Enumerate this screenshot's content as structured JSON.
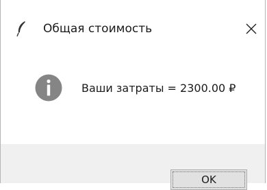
{
  "window": {
    "title": "Общая стоимость",
    "title_icon": "feather-icon",
    "close_icon": "close-icon"
  },
  "dialog": {
    "icon": "info-icon",
    "message": "Ваши затраты = 2300.00 ₽",
    "ok_label": "OK"
  },
  "colors": {
    "info_icon_fill": "#858585",
    "button_face": "#e1e1e1",
    "footer_bg": "#f0f0f0"
  }
}
